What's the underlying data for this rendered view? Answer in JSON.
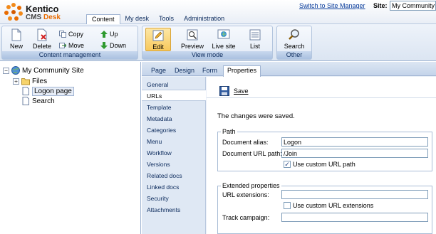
{
  "app": {
    "brand": "Kentico",
    "product_prefix": "CMS",
    "product_suffix": "Desk"
  },
  "top_tabs": [
    {
      "label": "Content",
      "active": true
    },
    {
      "label": "My desk",
      "active": false
    },
    {
      "label": "Tools",
      "active": false
    },
    {
      "label": "Administration",
      "active": false
    }
  ],
  "site_manager_link": "Switch to Site Manager",
  "site": {
    "label": "Site:",
    "selected": "My Community"
  },
  "toolbar": {
    "content_management": {
      "caption": "Content management",
      "new": "New",
      "delete": "Delete",
      "copy": "Copy",
      "move": "Move",
      "up": "Up",
      "down": "Down"
    },
    "view_mode": {
      "caption": "View mode",
      "edit": "Edit",
      "preview": "Preview",
      "live_site": "Live site",
      "list": "List"
    },
    "other": {
      "caption": "Other",
      "search": "Search"
    }
  },
  "tree": {
    "root": "My Community Site",
    "items": [
      "Files",
      "Logon page",
      "Search"
    ],
    "selected": "Logon page"
  },
  "sub_tabs": [
    {
      "label": "Page",
      "active": false
    },
    {
      "label": "Design",
      "active": false
    },
    {
      "label": "Form",
      "active": false
    },
    {
      "label": "Properties",
      "active": true
    }
  ],
  "vertical_nav": [
    "General",
    "URLs",
    "Template",
    "Metadata",
    "Categories",
    "Menu",
    "Workflow",
    "Versions",
    "Related docs",
    "Linked docs",
    "Security",
    "Attachments"
  ],
  "vertical_nav_active": "URLs",
  "save_label": "Save",
  "info_message": "The changes were saved.",
  "path_section": {
    "legend": "Path",
    "document_alias_label": "Document alias:",
    "document_alias_value": "Logon",
    "url_path_label": "Document URL path:",
    "url_path_value": "/Join",
    "use_custom_label": "Use custom URL path",
    "use_custom_checked": true
  },
  "extended_section": {
    "legend": "Extended properties",
    "url_extensions_label": "URL extensions:",
    "url_extensions_value": "",
    "use_custom_ext_label": "Use custom URL extensions",
    "use_custom_ext_checked": false,
    "track_campaign_label": "Track campaign:",
    "track_campaign_value": ""
  },
  "colors": {
    "accent_orange": "#e86b00",
    "link_blue": "#0b3e9c",
    "header_blue": "#9fb3d1"
  }
}
